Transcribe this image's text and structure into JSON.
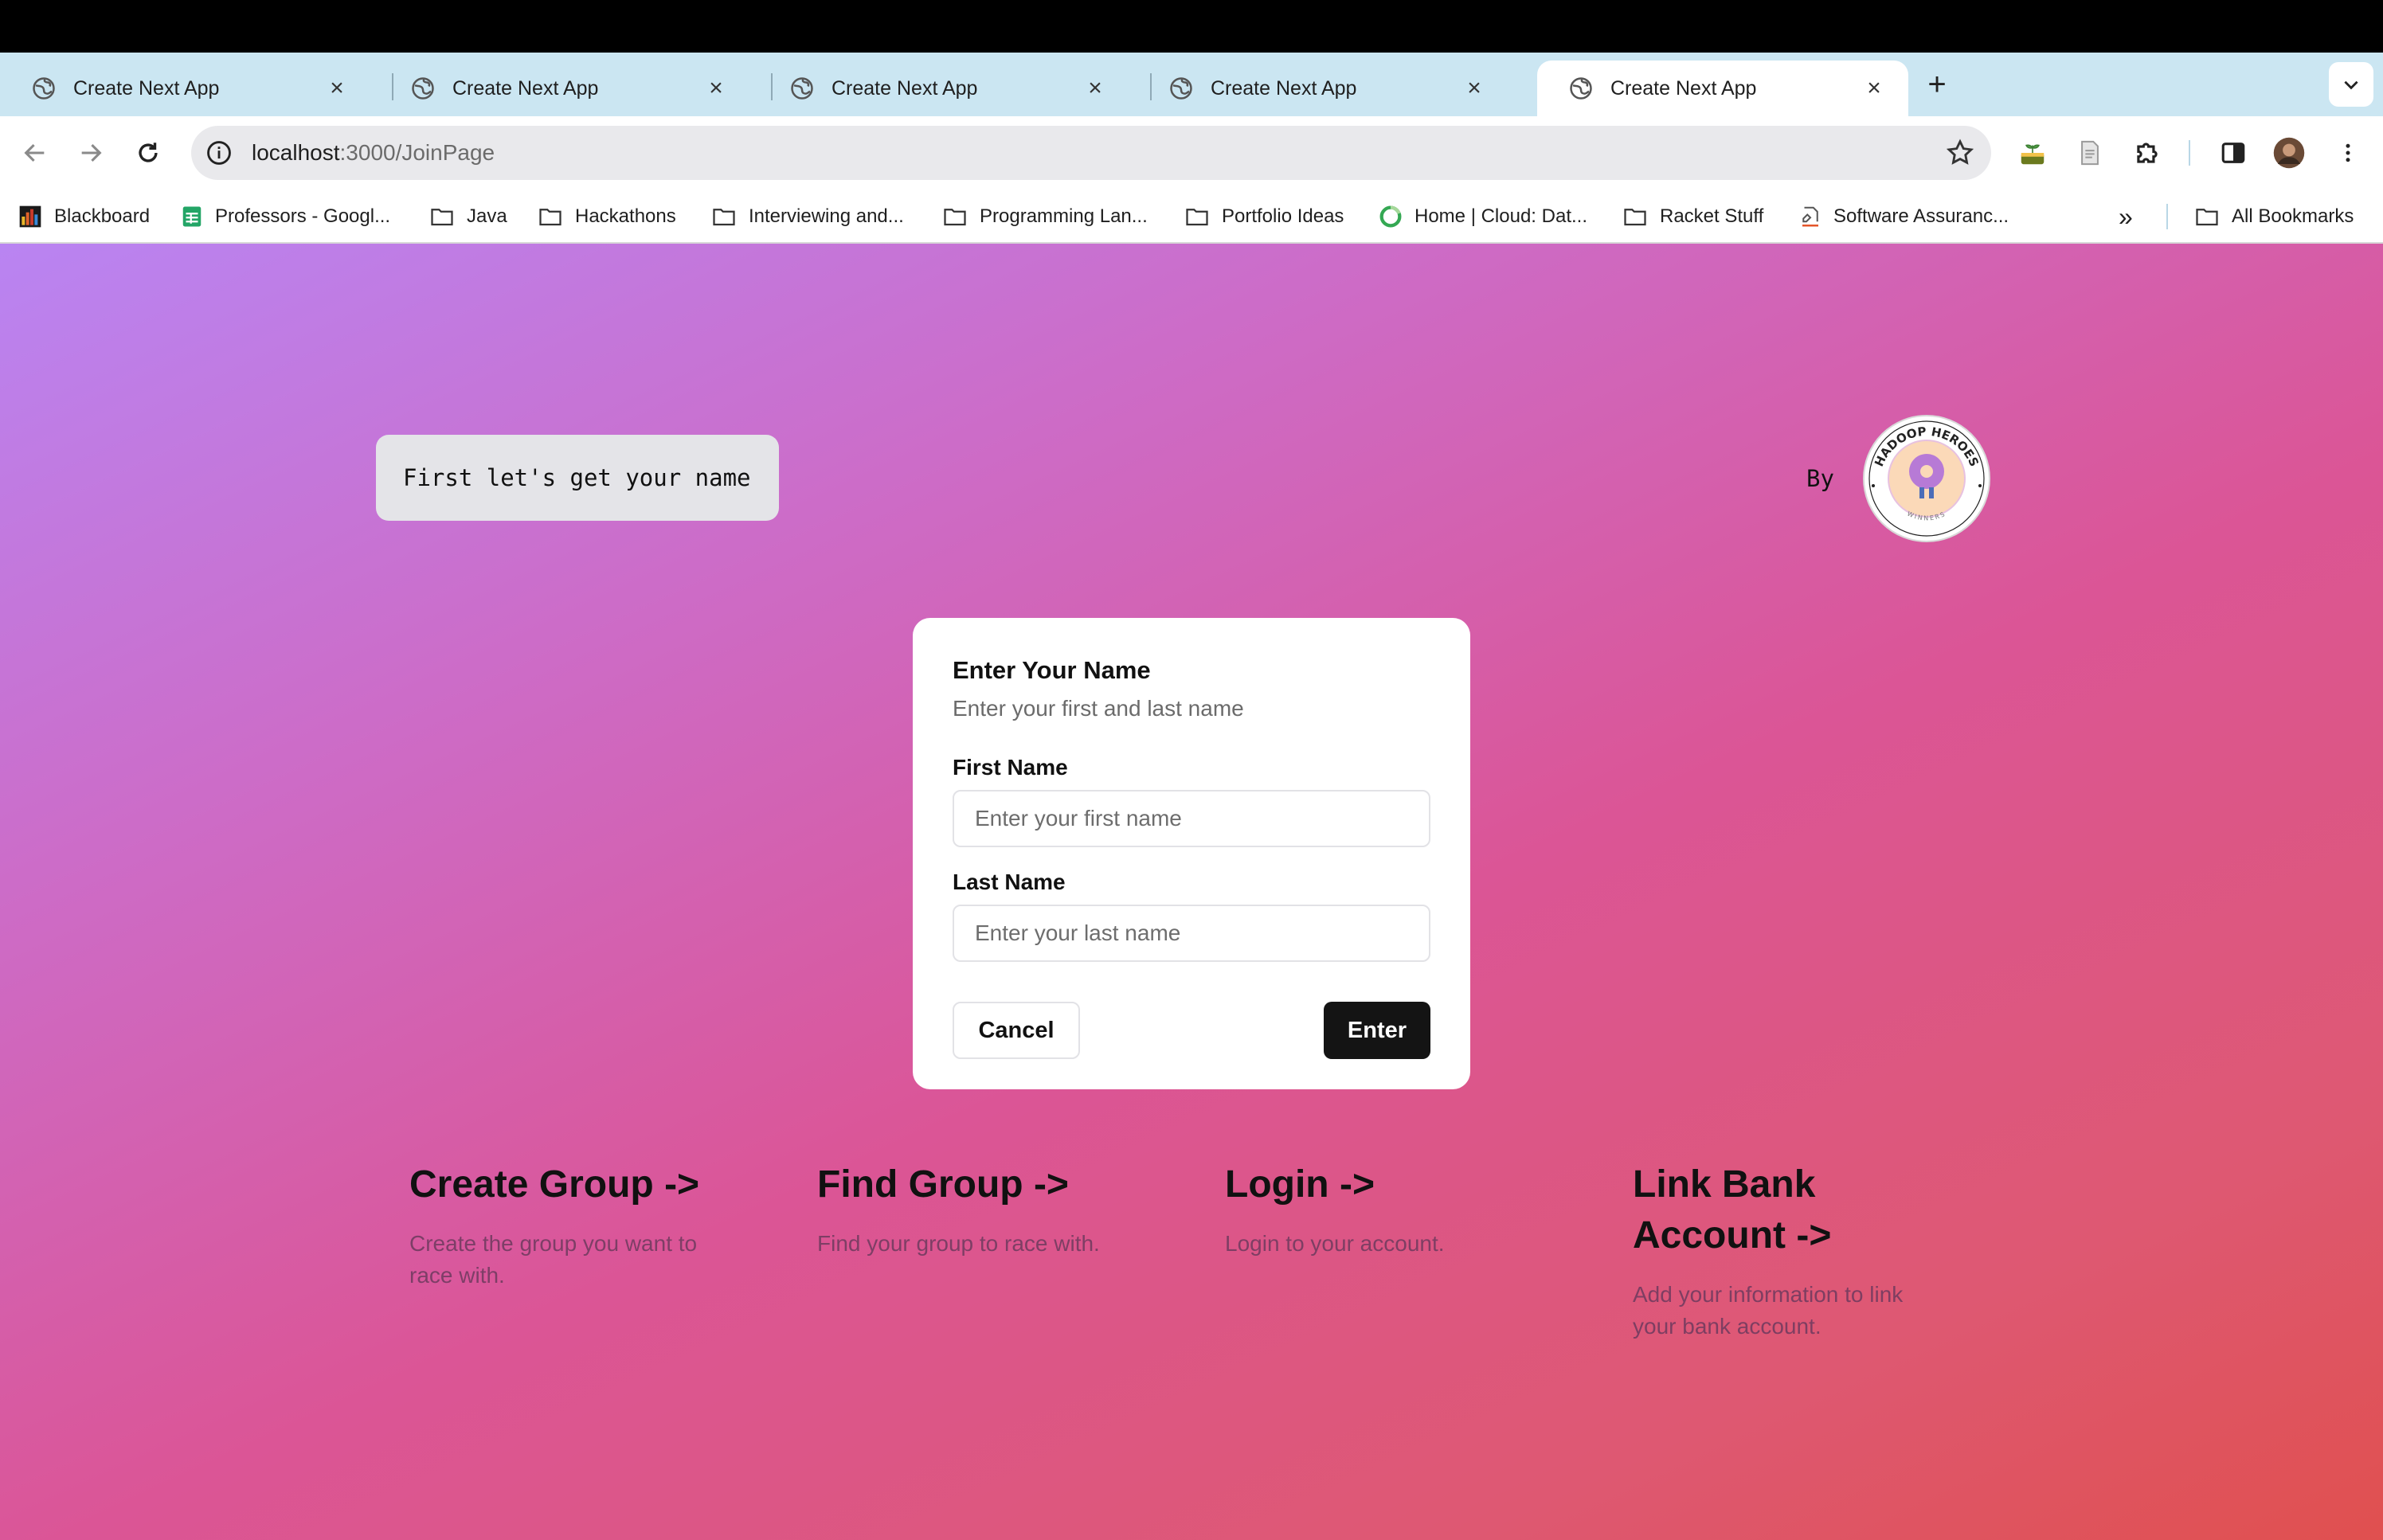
{
  "browser": {
    "tabs": [
      {
        "title": "Create Next App",
        "active": false
      },
      {
        "title": "Create Next App",
        "active": false
      },
      {
        "title": "Create Next App",
        "active": false
      },
      {
        "title": "Create Next App",
        "active": false
      },
      {
        "title": "Create Next App",
        "active": true
      }
    ],
    "url_host": "localhost",
    "url_path": ":3000/JoinPage",
    "bookmarks": [
      {
        "label": "Blackboard",
        "icon": "chart-icon"
      },
      {
        "label": "Professors - Googl...",
        "icon": "sheets-icon"
      },
      {
        "label": "Java",
        "icon": "folder-icon"
      },
      {
        "label": "Hackathons",
        "icon": "folder-icon"
      },
      {
        "label": "Interviewing and...",
        "icon": "folder-icon"
      },
      {
        "label": "Programming Lan...",
        "icon": "folder-icon"
      },
      {
        "label": "Portfolio Ideas",
        "icon": "folder-icon"
      },
      {
        "label": "Home | Cloud: Dat...",
        "icon": "ring-icon"
      },
      {
        "label": "Racket Stuff",
        "icon": "folder-icon"
      },
      {
        "label": "Software Assuranc...",
        "icon": "doc-icon"
      }
    ],
    "all_bookmarks": "All Bookmarks",
    "overflow": "»"
  },
  "page": {
    "prompt": "First let's get your name",
    "by": "By",
    "logo_text": "HADOOP HEROES",
    "logo_subtext": "WINNERS",
    "dialog": {
      "title": "Enter Your Name",
      "subtitle": "Enter your first and last name",
      "first_label": "First Name",
      "first_placeholder": "Enter your first name",
      "last_label": "Last Name",
      "last_placeholder": "Enter your last name",
      "cancel": "Cancel",
      "enter": "Enter"
    },
    "links": [
      {
        "title": "Create Group ->",
        "desc": "Create the group you want to race with."
      },
      {
        "title": "Find Group ->",
        "desc": "Find your group to race with."
      },
      {
        "title": "Login ->",
        "desc": "Login to your account."
      },
      {
        "title": "Link Bank Account ->",
        "desc": "Add your information to link your bank account."
      }
    ]
  }
}
